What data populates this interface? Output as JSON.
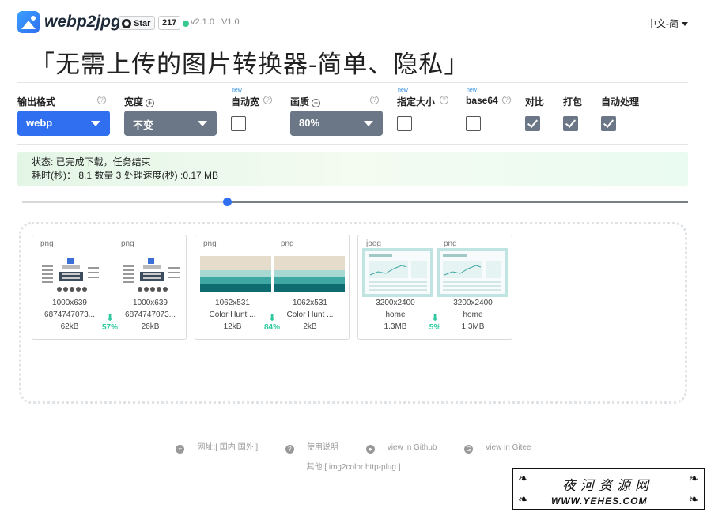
{
  "header": {
    "app_name": "webp2jpg",
    "github_star_label": "Star",
    "github_star_count": "217",
    "version": "v2.1.0",
    "version_alt": "V1.0",
    "language": "中文-简"
  },
  "title": "「无需上传的图片转换器-简单、隐私」",
  "options": {
    "output_format": {
      "label": "输出格式",
      "value": "webp"
    },
    "width": {
      "label": "宽度",
      "value": "不变"
    },
    "auto_width": {
      "label": "自动宽",
      "new": "new",
      "checked": false
    },
    "quality": {
      "label": "画质",
      "value": "80%"
    },
    "fixed_size": {
      "label": "指定大小",
      "new": "new",
      "checked": false
    },
    "base64": {
      "label": "base64",
      "new": "new",
      "checked": false
    },
    "compare": {
      "label": "对比",
      "checked": true
    },
    "pack": {
      "label": "打包",
      "checked": true
    },
    "auto_process": {
      "label": "自动处理",
      "checked": true
    }
  },
  "status": {
    "line1": "状态: 已完成下载，任务结束",
    "line2": "耗时(秒)： 8.1 数量 3 处理速度(秒) :0.17 MB"
  },
  "results": [
    {
      "before": {
        "format": "png",
        "dims": "1000x639",
        "name": "6874747073...",
        "size": "62kB"
      },
      "after": {
        "format": "png",
        "dims": "1000x639",
        "name": "6874747073...",
        "size": "26kB"
      },
      "reduction": "57%"
    },
    {
      "before": {
        "format": "png",
        "dims": "1062x531",
        "name": "Color Hunt ...",
        "size": "12kB"
      },
      "after": {
        "format": "png",
        "dims": "1062x531",
        "name": "Color Hunt ...",
        "size": "2kB"
      },
      "reduction": "84%"
    },
    {
      "before": {
        "format": "jpeg",
        "dims": "3200x2400",
        "name": "home",
        "size": "1.3MB"
      },
      "after": {
        "format": "png",
        "dims": "3200x2400",
        "name": "home",
        "size": "1.3MB"
      },
      "reduction": "5%"
    }
  ],
  "footer": {
    "site_label": "网址:[ 国内 国外 ]",
    "help_label": "使用说明",
    "github_label": "view in Github",
    "gitee_label": "view in Gitee",
    "others_label": "其他:[ img2color  http-plug ]"
  },
  "watermark": {
    "zh": "夜河资源网",
    "en": "WWW.YEHES.COM"
  },
  "colors": {
    "primary": "#2f6ff0",
    "select_grey": "#6b7686",
    "success": "#2fc9a0",
    "palette_cream": "#e6dccb",
    "palette_teal_light": "#a8d8d2",
    "palette_teal": "#3fa7a3",
    "palette_teal_dark": "#0e6b70"
  }
}
